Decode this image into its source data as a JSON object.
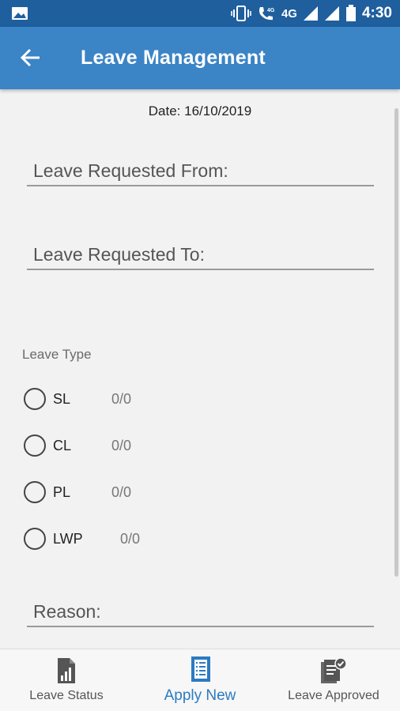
{
  "status_bar": {
    "network": "4G",
    "time": "4:30"
  },
  "app_bar": {
    "title": "Leave Management",
    "back_icon": "arrow-back-icon"
  },
  "form": {
    "date_text": "Date: 16/10/2019",
    "from_placeholder": "Leave Requested From:",
    "to_placeholder": "Leave Requested To:",
    "leave_type_label": "Leave Type",
    "leave_types": [
      {
        "label": "SL",
        "count": "0/0"
      },
      {
        "label": "CL",
        "count": "0/0"
      },
      {
        "label": "PL",
        "count": "0/0"
      },
      {
        "label": "LWP",
        "count": "0/0"
      }
    ],
    "reason_placeholder": "Reason:"
  },
  "bottom_nav": {
    "items": [
      {
        "label": "Leave Status",
        "icon": "bar-chart-document-icon",
        "active": false
      },
      {
        "label": "Apply New",
        "icon": "document-list-icon",
        "active": true
      },
      {
        "label": "Leave Approved",
        "icon": "approved-document-icon",
        "active": false
      }
    ]
  },
  "colors": {
    "primary": "#3b84c6",
    "status_bar": "#1f5f9e",
    "active_nav": "#2b7bc1"
  }
}
